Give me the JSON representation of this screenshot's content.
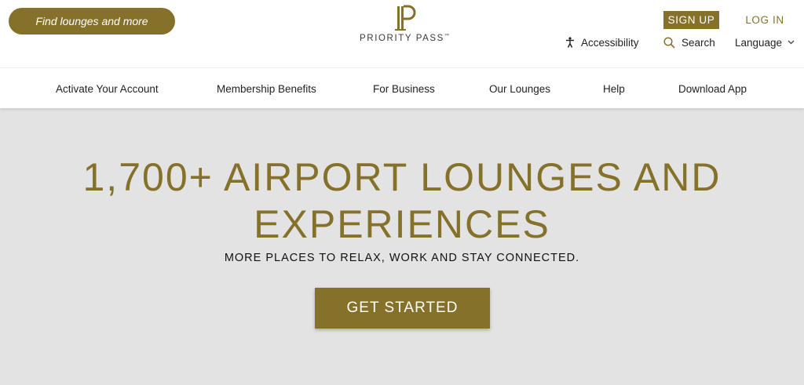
{
  "header": {
    "find_button": "Find lounges and more",
    "logo_text": "PRIORITY PASS",
    "logo_tm": "™",
    "signup": "SIGN UP",
    "login": "LOG IN",
    "accessibility": "Accessibility",
    "search": "Search",
    "language": "Language",
    "language_chevron": "⌄"
  },
  "nav": {
    "items": [
      "Activate Your Account",
      "Membership Benefits",
      "For Business",
      "Our Lounges",
      "Help",
      "Download App"
    ]
  },
  "hero": {
    "title": "1,700+ AIRPORT LOUNGES AND EXPERIENCES",
    "subtitle": "MORE PLACES TO RELAX, WORK AND STAY CONNECTED.",
    "cta": "GET STARTED"
  },
  "colors": {
    "brand_gold": "#85712a",
    "hero_bg": "#e3e3e3",
    "text_dark": "#222222"
  },
  "icons": {
    "accessibility": "accessibility-person-icon",
    "search": "search-icon",
    "language": "chevron-down-icon",
    "logo": "priority-pass-logo-mark"
  }
}
